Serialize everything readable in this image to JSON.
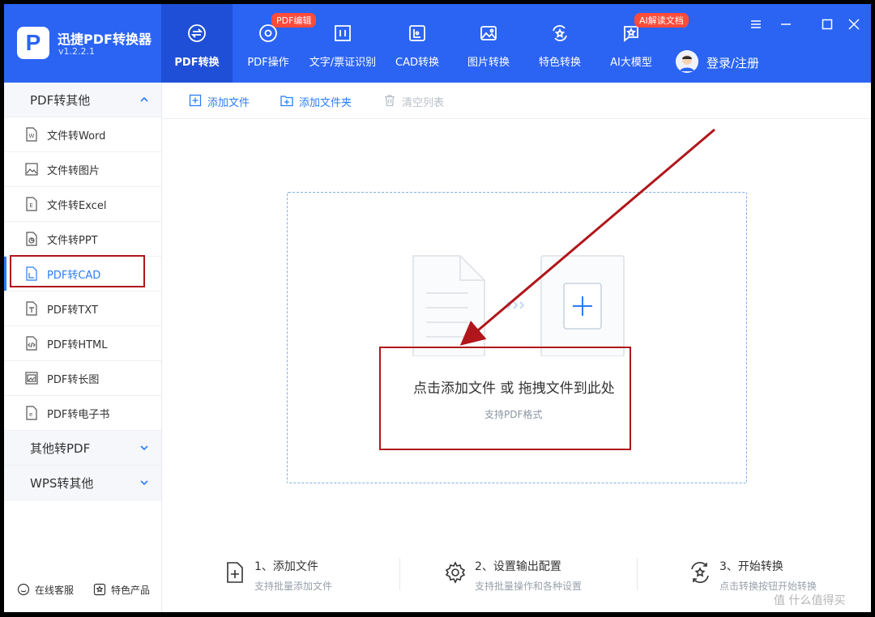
{
  "app": {
    "name": "迅捷PDF转换器",
    "version": "v1.2.2.1"
  },
  "nav": [
    {
      "label": "PDF转换",
      "icon": "convert-icon",
      "active": true
    },
    {
      "label": "PDF操作",
      "icon": "gear-chat-icon",
      "badge": "PDF编辑"
    },
    {
      "label": "文字/票证识别",
      "icon": "scan-icon"
    },
    {
      "label": "CAD转换",
      "icon": "cad-icon"
    },
    {
      "label": "图片转换",
      "icon": "image-icon"
    },
    {
      "label": "特色转换",
      "icon": "star-convert-icon"
    },
    {
      "label": "AI大模型",
      "icon": "ai-chat-icon",
      "badge": "AI解读文档"
    }
  ],
  "login": {
    "label": "登录/注册"
  },
  "sidebar": {
    "groups": [
      {
        "label": "PDF转其他",
        "expanded": true
      },
      {
        "label": "其他转PDF",
        "expanded": false
      },
      {
        "label": "WPS转其他",
        "expanded": false
      }
    ],
    "items": [
      {
        "label": "文件转Word",
        "icon": "word-file-icon"
      },
      {
        "label": "文件转图片",
        "icon": "image-file-icon"
      },
      {
        "label": "文件转Excel",
        "icon": "excel-file-icon"
      },
      {
        "label": "文件转PPT",
        "icon": "ppt-file-icon"
      },
      {
        "label": "PDF转CAD",
        "icon": "cad-file-icon",
        "active": true
      },
      {
        "label": "PDF转TXT",
        "icon": "txt-file-icon"
      },
      {
        "label": "PDF转HTML",
        "icon": "html-file-icon"
      },
      {
        "label": "PDF转长图",
        "icon": "long-image-icon"
      },
      {
        "label": "PDF转电子书",
        "icon": "ebook-file-icon"
      }
    ],
    "footer": {
      "support": "在线客服",
      "products": "特色产品"
    }
  },
  "toolbar": {
    "add_file": "添加文件",
    "add_folder": "添加文件夹",
    "clear_list": "清空列表"
  },
  "dropzone": {
    "main": "点击添加文件 或 拖拽文件到此处",
    "sub": "支持PDF格式"
  },
  "steps": [
    {
      "title": "1、添加文件",
      "desc": "支持批量添加文件"
    },
    {
      "title": "2、设置输出配置",
      "desc": "支持批量操作和各种设置"
    },
    {
      "title": "3、开始转换",
      "desc": "点击转换按钮开始转换"
    }
  ],
  "watermark": "值 什么值得买",
  "colors": {
    "header": "#2b64f3",
    "accent": "#2b7cf6",
    "annotation": "#b0161b"
  }
}
